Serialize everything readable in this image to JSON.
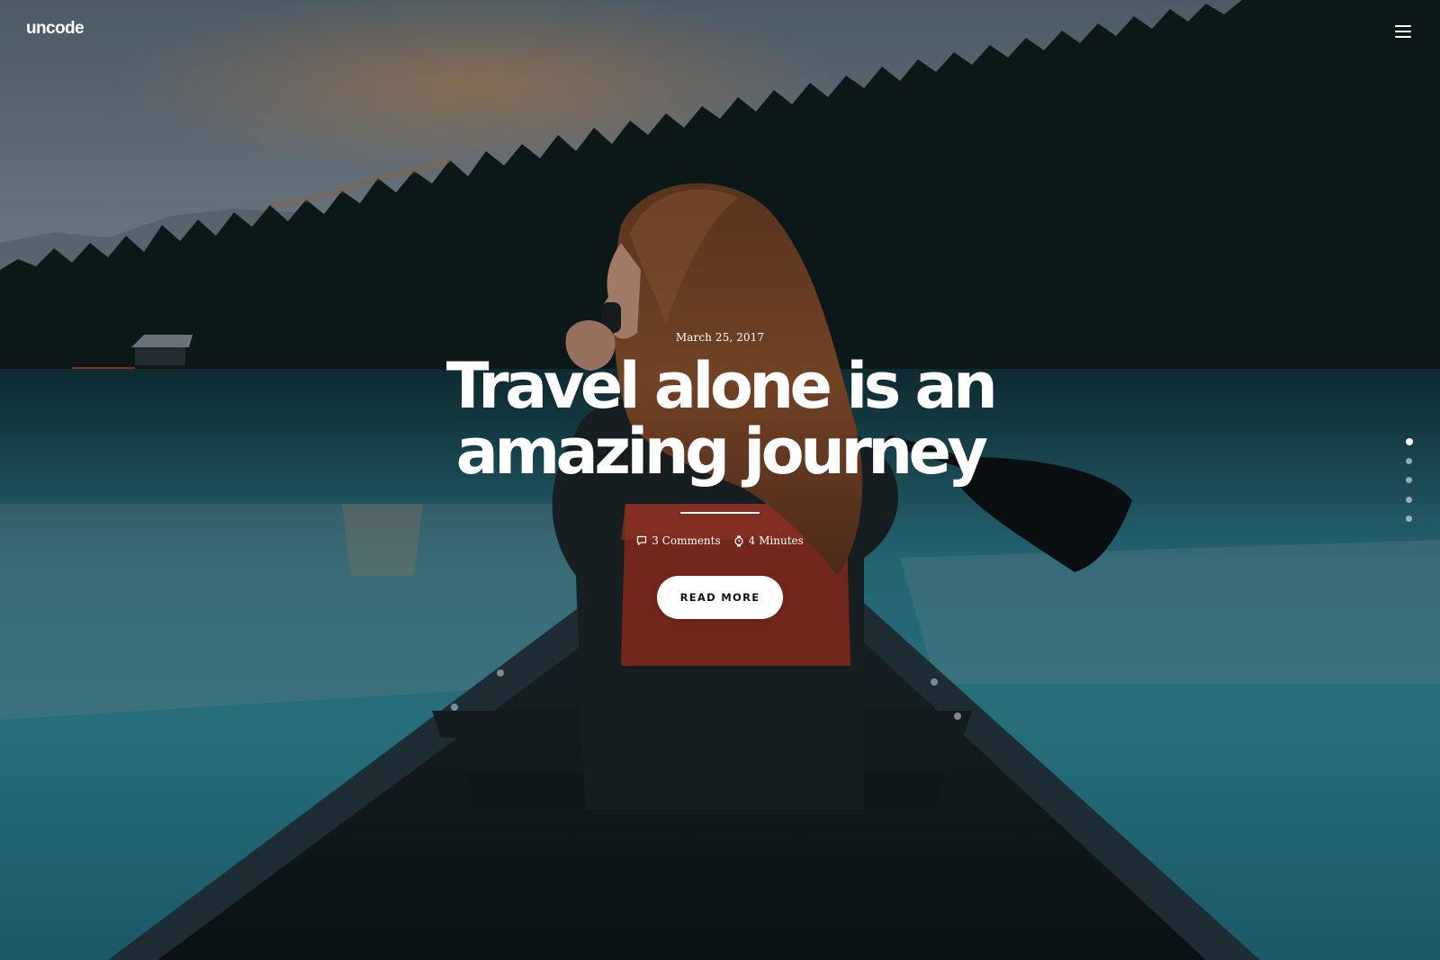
{
  "site": {
    "logo": "uncode"
  },
  "header": {
    "menu_icon": "hamburger-menu-icon"
  },
  "post": {
    "date": "March 25, 2017",
    "title_line_1": "Travel alone is an",
    "title_line_2": "amazing journey",
    "comments": "3 Comments",
    "comments_icon": "comment-icon",
    "reading_time": "4 Minutes",
    "reading_time_icon": "watch-icon",
    "cta": "READ MORE"
  },
  "slider": {
    "total_slides": 5,
    "active_slide": 1
  },
  "colors": {
    "text": "#ffffff",
    "button_bg": "#ffffff",
    "button_text": "#111111",
    "lake": "#2d7f8e"
  }
}
